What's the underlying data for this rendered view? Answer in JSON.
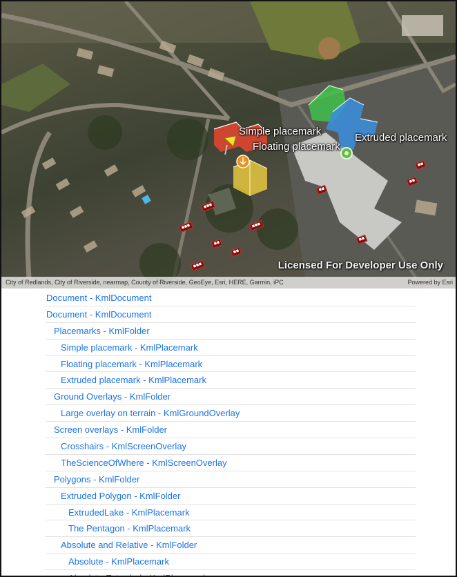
{
  "map": {
    "labels": {
      "simple": "Simple placemark",
      "floating": "Floating placemark",
      "extruded": "Extruded placemark"
    },
    "watermark": "Licensed For Developer Use Only",
    "attribution": "City of Redlands, City of Riverside, nearmap, County of Riverside, GeoEye, Esri, HERE, Garmin, iPC",
    "powered_by": "Powered by Esri",
    "colors": {
      "red_model": "#e8472f",
      "yellow_model": "#f0d040",
      "green_model": "#3fc04a",
      "blue_model": "#3a8fe0",
      "link": "#1a73e8"
    }
  },
  "nodes": [
    {
      "label": "Document - KmlDocument",
      "level": 0
    },
    {
      "label": "Document - KmlDocument",
      "level": 0
    },
    {
      "label": "Placemarks - KmlFolder",
      "level": 1
    },
    {
      "label": "Simple placemark - KmlPlacemark",
      "level": 2
    },
    {
      "label": "Floating placemark - KmlPlacemark",
      "level": 2
    },
    {
      "label": "Extruded placemark - KmlPlacemark",
      "level": 2
    },
    {
      "label": "Ground Overlays - KmlFolder",
      "level": 1
    },
    {
      "label": "Large overlay on terrain - KmlGroundOverlay",
      "level": 2
    },
    {
      "label": "Screen overlays - KmlFolder",
      "level": 1
    },
    {
      "label": "Crosshairs - KmlScreenOverlay",
      "level": 2
    },
    {
      "label": "TheScienceOfWhere - KmlScreenOverlay",
      "level": 2
    },
    {
      "label": "Polygons - KmlFolder",
      "level": 1
    },
    {
      "label": "Extruded Polygon - KmlFolder",
      "level": 2
    },
    {
      "label": "ExtrudedLake - KmlPlacemark",
      "level": 3
    },
    {
      "label": "The Pentagon - KmlPlacemark",
      "level": 3
    },
    {
      "label": "Absolute and Relative - KmlFolder",
      "level": 2
    },
    {
      "label": "Absolute - KmlPlacemark",
      "level": 3
    },
    {
      "label": "Absolute Extruded - KmlPlacemark",
      "level": 3
    }
  ]
}
